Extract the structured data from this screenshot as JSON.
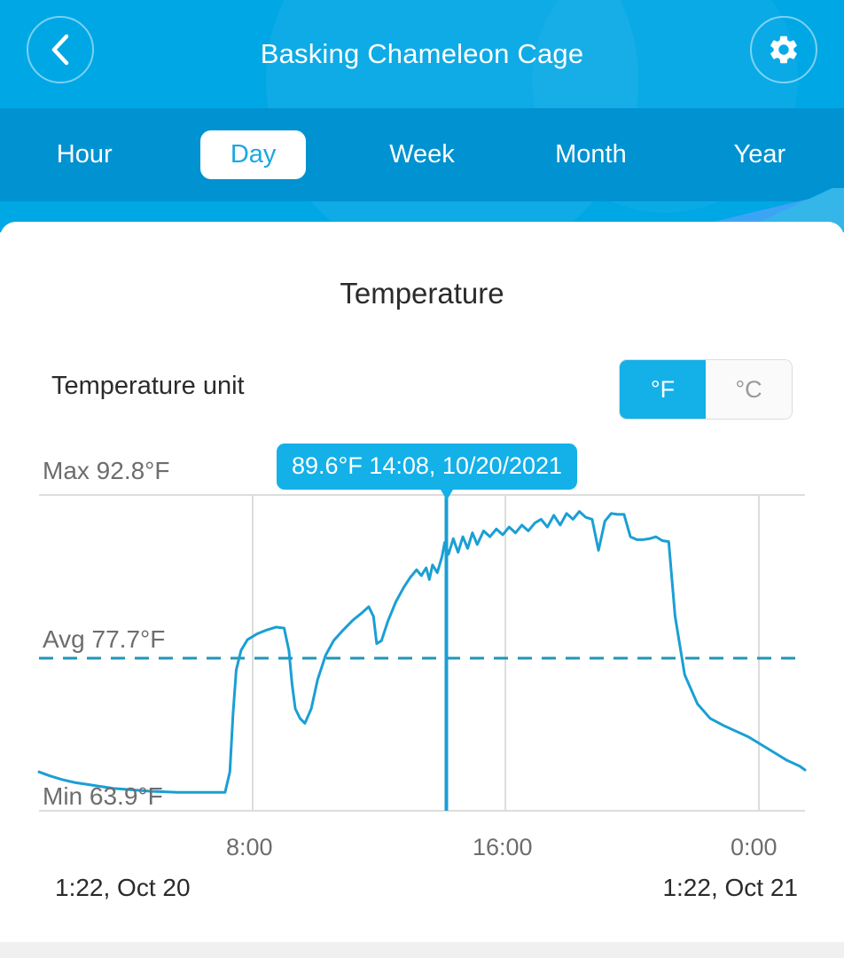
{
  "header": {
    "title": "Basking Chameleon Cage",
    "back_icon": "chevron-left-icon",
    "settings_icon": "gear-icon",
    "bg_color": "#00a7e5",
    "tabbar_bg_color": "#0092d1"
  },
  "tabs": [
    {
      "label": "Hour",
      "active": false
    },
    {
      "label": "Day",
      "active": true
    },
    {
      "label": "Week",
      "active": false
    },
    {
      "label": "Month",
      "active": false
    },
    {
      "label": "Year",
      "active": false
    }
  ],
  "card": {
    "chart_title": "Temperature",
    "unit_label": "Temperature unit",
    "unit_options": [
      {
        "label": "°F",
        "selected": true
      },
      {
        "label": "°C",
        "selected": false
      }
    ],
    "accent_color": "#14b0e8"
  },
  "stats": {
    "max": "Max 92.8°F",
    "avg": "Avg 77.7°F",
    "min": "Min 63.9°F"
  },
  "tooltip": {
    "text": "89.6°F 14:08,  10/20/2021"
  },
  "range": {
    "start": "1:22,  Oct 20",
    "end": "1:22,  Oct 21"
  },
  "chart_data": {
    "type": "line",
    "title": "Temperature",
    "xlabel": "",
    "ylabel": "",
    "unit": "°F",
    "grid": true,
    "legend": "none",
    "series_color": "#1a9fd4",
    "avg_line_color": "#2196b5",
    "xtick_labels": [
      "8:00",
      "16:00",
      "0:00"
    ],
    "xtick_positions": [
      8,
      16,
      24
    ],
    "xlim": [
      1.37,
      25.37
    ],
    "ylim": [
      62.0,
      94.5
    ],
    "max_value": 92.8,
    "avg_value": 77.7,
    "min_value": 63.9,
    "cursor": {
      "x_time": "14:08",
      "date": "10/20/2021",
      "value": 89.6
    },
    "series": [
      {
        "name": "Temperature",
        "x": [
          1.37,
          1.7,
          2.1,
          2.5,
          2.9,
          3.3,
          3.7,
          4.1,
          4.5,
          4.9,
          5.3,
          5.7,
          6.1,
          6.5,
          6.9,
          7.2,
          7.35,
          7.45,
          7.55,
          7.7,
          7.9,
          8.2,
          8.5,
          8.8,
          9.05,
          9.2,
          9.3,
          9.4,
          9.55,
          9.7,
          9.9,
          10.1,
          10.35,
          10.6,
          10.9,
          11.2,
          11.5,
          11.7,
          11.85,
          11.95,
          12.1,
          12.3,
          12.55,
          12.8,
          13.0,
          13.2,
          13.35,
          13.5,
          13.6,
          13.7,
          13.85,
          14.0,
          14.08,
          14.2,
          14.35,
          14.5,
          14.65,
          14.8,
          14.95,
          15.1,
          15.3,
          15.5,
          15.7,
          15.9,
          16.1,
          16.3,
          16.5,
          16.7,
          16.9,
          17.1,
          17.3,
          17.5,
          17.7,
          17.9,
          18.1,
          18.3,
          18.5,
          18.7,
          18.9,
          19.1,
          19.3,
          19.5,
          19.7,
          19.9,
          20.1,
          20.3,
          20.5,
          20.7,
          20.9,
          21.1,
          21.3,
          21.6,
          22.0,
          22.4,
          22.8,
          23.2,
          23.6,
          24.0,
          24.4,
          24.8,
          25.2,
          25.37
        ],
        "values": [
          66.0,
          65.6,
          65.2,
          64.9,
          64.7,
          64.5,
          64.3,
          64.2,
          64.1,
          64.0,
          63.95,
          63.9,
          63.9,
          63.9,
          63.9,
          63.9,
          66.0,
          72.0,
          76.5,
          78.5,
          79.6,
          80.2,
          80.6,
          80.9,
          80.8,
          78.5,
          75.0,
          72.5,
          71.5,
          71.0,
          72.5,
          75.5,
          78.0,
          79.5,
          80.6,
          81.6,
          82.4,
          83.0,
          82.0,
          79.2,
          79.5,
          81.5,
          83.5,
          85.0,
          86.0,
          86.8,
          86.2,
          87.0,
          85.8,
          87.3,
          86.5,
          88.2,
          89.6,
          88.4,
          90.0,
          88.6,
          90.2,
          89.0,
          90.6,
          89.4,
          90.8,
          90.2,
          91.0,
          90.4,
          91.2,
          90.6,
          91.4,
          90.8,
          91.6,
          92.0,
          91.2,
          92.4,
          91.4,
          92.6,
          92.0,
          92.8,
          92.2,
          92.0,
          88.8,
          91.8,
          92.6,
          92.5,
          92.5,
          90.2,
          89.9,
          89.9,
          90.0,
          90.2,
          89.8,
          89.7,
          82.0,
          76.0,
          73.0,
          71.5,
          70.8,
          70.2,
          69.6,
          68.8,
          68.0,
          67.2,
          66.6,
          66.2
        ]
      }
    ]
  }
}
